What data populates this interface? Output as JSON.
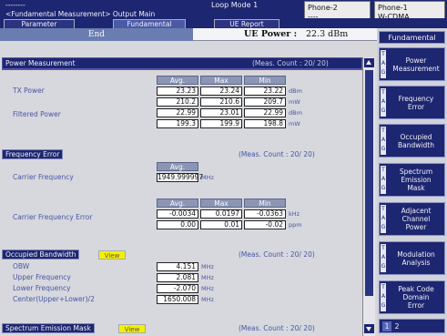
{
  "header": {
    "title_line1": "--------",
    "title_line2": "<Fundamental Measurement> Output Main",
    "loop_mode": "Loop Mode 1",
    "phone2": {
      "name": "Phone-2",
      "mode": "----"
    },
    "phone1": {
      "name": "Phone-1",
      "mode": "W-CDMA"
    }
  },
  "tabs": {
    "parameter": "Parameter",
    "fundamental": "Fundamental",
    "ue_report": "UE Report"
  },
  "status": {
    "state": "End",
    "ue_power_label": "UE Power :",
    "ue_power_value": "22.3 dBm"
  },
  "columns": {
    "avg": "Avg.",
    "max": "Max",
    "min": "Min"
  },
  "power": {
    "title": "Power Measurement",
    "meas_count": "(Meas. Count :    20/  20)",
    "tx_label": "TX Power",
    "filt_label": "Filtered Power",
    "tx_dbm": [
      "23.23",
      "23.24",
      "23.22"
    ],
    "tx_mw": [
      "210.2",
      "210.6",
      "209.7"
    ],
    "filt_dbm": [
      "22.99",
      "23.01",
      "22.99"
    ],
    "filt_mw": [
      "199.3",
      "199.9",
      "198.8"
    ],
    "unit_dbm": "dBm",
    "unit_mw": "mW"
  },
  "freq": {
    "title": "Frequency Error",
    "meas_count": "(Meas. Count :    20/  20)",
    "carrier_label": "Carrier Frequency",
    "carrier_value": "1949.999997",
    "carrier_unit": "MHz",
    "err_label": "Carrier Frequency Error",
    "err_khz": [
      "-0.0034",
      "0.0197",
      "-0.0363"
    ],
    "err_ppm": [
      "0.00",
      "0.01",
      "-0.02"
    ],
    "unit_khz": "kHz",
    "unit_ppm": "ppm"
  },
  "obw": {
    "title": "Occupied Bandwidth",
    "view": "View",
    "meas_count": "(Meas. Count :    20/  20)",
    "rows": [
      {
        "label": "OBW",
        "value": "4.151",
        "unit": "MHz"
      },
      {
        "label": "Upper Frequency",
        "value": "2.081",
        "unit": "MHz"
      },
      {
        "label": "Lower Frequency",
        "value": "-2.070",
        "unit": "MHz"
      },
      {
        "label": "Center(Upper+Lower)/2",
        "value": "1650.008",
        "unit": "MHz"
      }
    ]
  },
  "sem": {
    "title": "Spectrum Emission Mask",
    "view": "View",
    "meas_count": "(Meas. Count :    20/  20)"
  },
  "menu": {
    "title": "Fundamental",
    "keys": [
      {
        "tag": "TAG",
        "label": "Power\nMeasurement"
      },
      {
        "tag": "TAG",
        "label": "Frequency\nError"
      },
      {
        "tag": "TAG",
        "label": "Occupied\nBandwidth"
      },
      {
        "tag": "TAG",
        "label": "Spectrum\nEmission\nMask"
      },
      {
        "tag": "TAG",
        "label": "Adjacent\nChannel\nPower"
      },
      {
        "tag": "TAG",
        "label": "Modulation\nAnalysis"
      },
      {
        "tag": "TAG",
        "label": "Peak Code\nDomain\nError"
      }
    ],
    "pages": [
      "1",
      "2"
    ]
  },
  "colors": {
    "navy": "#1d2670",
    "accent_blue": "#6a7db0",
    "view_yellow": "#f4f000",
    "divider_red": "#c83030"
  }
}
